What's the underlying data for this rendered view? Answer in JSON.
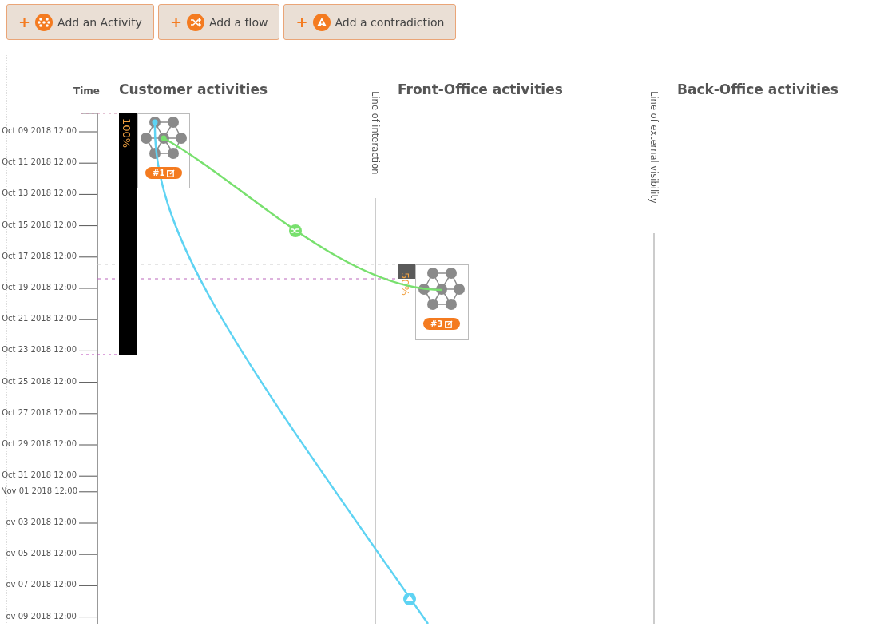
{
  "toolbar": [
    {
      "plus": "+",
      "label": "Add an Activity",
      "kind": "activity"
    },
    {
      "plus": "+",
      "label": "Add a flow",
      "kind": "flow"
    },
    {
      "plus": "+",
      "label": "Add a contradiction",
      "kind": "contradiction"
    }
  ],
  "axis": {
    "title": "Time",
    "ticks": [
      {
        "label": "Oct 09 2018 12:00",
        "kind": "two_day"
      },
      {
        "label": "Oct 11 2018 12:00",
        "kind": "two_day"
      },
      {
        "label": "Oct 13 2018 12:00",
        "kind": "two_day"
      },
      {
        "label": "Oct 15 2018 12:00",
        "kind": "two_day"
      },
      {
        "label": "Oct 17 2018 12:00",
        "kind": "two_day"
      },
      {
        "label": "Oct 19 2018 12:00",
        "kind": "two_day"
      },
      {
        "label": "Oct 21 2018 12:00",
        "kind": "two_day"
      },
      {
        "label": "Oct 23 2018 12:00",
        "kind": "two_day"
      },
      {
        "label": "Oct 25 2018 12:00",
        "kind": "two_day"
      },
      {
        "label": "Oct 27 2018 12:00",
        "kind": "two_day"
      },
      {
        "label": "Oct 29 2018 12:00",
        "kind": "two_day"
      },
      {
        "label": "Oct 31 2018 12:00",
        "kind": "two_day"
      },
      {
        "label": "Nov 01 2018 12:00",
        "kind": "one_day"
      },
      {
        "label": "ov 03 2018 12:00",
        "kind": "two_day"
      },
      {
        "label": "ov 05 2018 12:00",
        "kind": "two_day"
      },
      {
        "label": "ov 07 2018 12:00",
        "kind": "two_day"
      },
      {
        "label": "ov 09 2018 12:00",
        "kind": "two_day"
      }
    ]
  },
  "lanes": [
    {
      "title": "Customer activities"
    },
    {
      "title": "Front-Office activities"
    },
    {
      "title": "Back-Office activities"
    }
  ],
  "lines": [
    {
      "label": "Line of interaction"
    },
    {
      "label": "Line of external visibility"
    }
  ],
  "activities": [
    {
      "badge": "#1",
      "percent": "100%",
      "color": "#000000"
    },
    {
      "badge": "#3",
      "percent": "50%",
      "color": "#5a5a5a"
    }
  ],
  "flows": [
    {
      "kind": "flow",
      "color": "#78e06e"
    },
    {
      "kind": "contradiction",
      "color": "#5ed3f3"
    }
  ]
}
